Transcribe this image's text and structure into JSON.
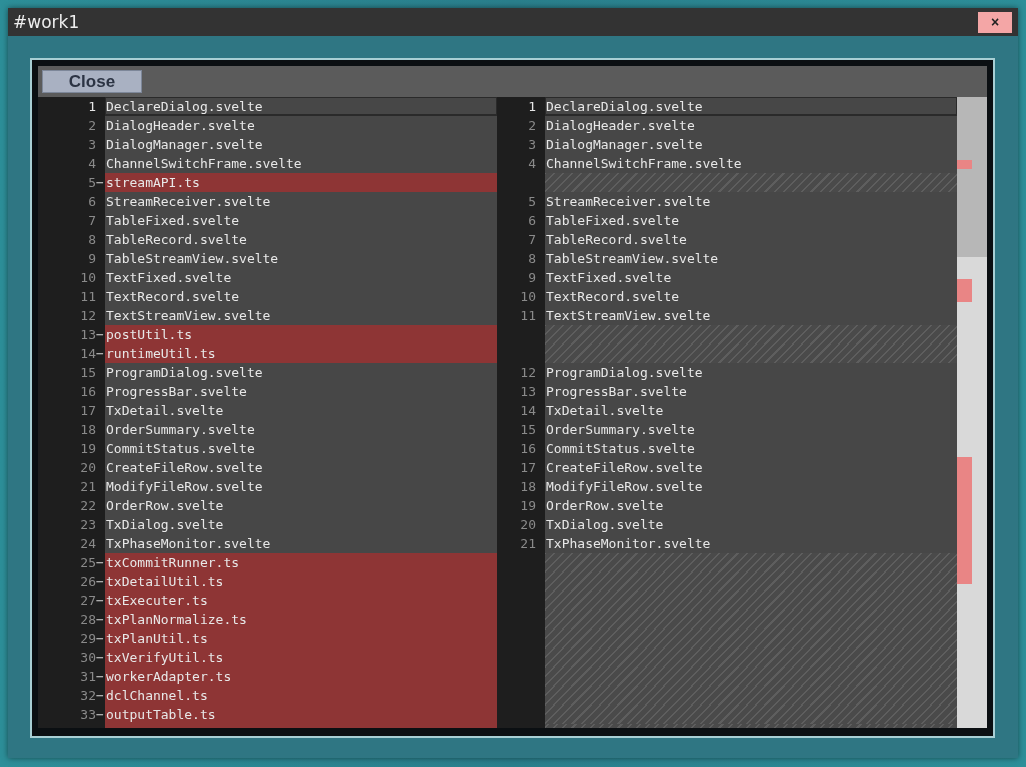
{
  "window": {
    "title": "#work1",
    "close_label": "×"
  },
  "dialog": {
    "close_button": "Close"
  },
  "diff_rows": [
    {
      "kind": "same",
      "current": true,
      "left_number": "1",
      "left_text": "DeclareDialog.svelte",
      "right_number": "1",
      "right_text": "DeclareDialog.svelte"
    },
    {
      "kind": "same",
      "current": false,
      "left_number": "2",
      "left_text": "DialogHeader.svelte",
      "right_number": "2",
      "right_text": "DialogHeader.svelte"
    },
    {
      "kind": "same",
      "current": false,
      "left_number": "3",
      "left_text": "DialogManager.svelte",
      "right_number": "3",
      "right_text": "DialogManager.svelte"
    },
    {
      "kind": "same",
      "current": false,
      "left_number": "4",
      "left_text": "ChannelSwitchFrame.svelte",
      "right_number": "4",
      "right_text": "ChannelSwitchFrame.svelte"
    },
    {
      "kind": "removed",
      "current": false,
      "left_number": "5",
      "marker": "−",
      "left_text": "streamAPI.ts"
    },
    {
      "kind": "same",
      "current": false,
      "left_number": "6",
      "left_text": "StreamReceiver.svelte",
      "right_number": "5",
      "right_text": "StreamReceiver.svelte"
    },
    {
      "kind": "same",
      "current": false,
      "left_number": "7",
      "left_text": "TableFixed.svelte",
      "right_number": "6",
      "right_text": "TableFixed.svelte"
    },
    {
      "kind": "same",
      "current": false,
      "left_number": "8",
      "left_text": "TableRecord.svelte",
      "right_number": "7",
      "right_text": "TableRecord.svelte"
    },
    {
      "kind": "same",
      "current": false,
      "left_number": "9",
      "left_text": "TableStreamView.svelte",
      "right_number": "8",
      "right_text": "TableStreamView.svelte"
    },
    {
      "kind": "same",
      "current": false,
      "left_number": "10",
      "left_text": "TextFixed.svelte",
      "right_number": "9",
      "right_text": "TextFixed.svelte"
    },
    {
      "kind": "same",
      "current": false,
      "left_number": "11",
      "left_text": "TextRecord.svelte",
      "right_number": "10",
      "right_text": "TextRecord.svelte"
    },
    {
      "kind": "same",
      "current": false,
      "left_number": "12",
      "left_text": "TextStreamView.svelte",
      "right_number": "11",
      "right_text": "TextStreamView.svelte"
    },
    {
      "kind": "removed",
      "current": false,
      "left_number": "13",
      "marker": "−",
      "left_text": "postUtil.ts"
    },
    {
      "kind": "removed",
      "current": false,
      "left_number": "14",
      "marker": "−",
      "left_text": "runtimeUtil.ts"
    },
    {
      "kind": "same",
      "current": false,
      "left_number": "15",
      "left_text": "ProgramDialog.svelte",
      "right_number": "12",
      "right_text": "ProgramDialog.svelte"
    },
    {
      "kind": "same",
      "current": false,
      "left_number": "16",
      "left_text": "ProgressBar.svelte",
      "right_number": "13",
      "right_text": "ProgressBar.svelte"
    },
    {
      "kind": "same",
      "current": false,
      "left_number": "17",
      "left_text": "TxDetail.svelte",
      "right_number": "14",
      "right_text": "TxDetail.svelte"
    },
    {
      "kind": "same",
      "current": false,
      "left_number": "18",
      "left_text": "OrderSummary.svelte",
      "right_number": "15",
      "right_text": "OrderSummary.svelte"
    },
    {
      "kind": "same",
      "current": false,
      "left_number": "19",
      "left_text": "CommitStatus.svelte",
      "right_number": "16",
      "right_text": "CommitStatus.svelte"
    },
    {
      "kind": "same",
      "current": false,
      "left_number": "20",
      "left_text": "CreateFileRow.svelte",
      "right_number": "17",
      "right_text": "CreateFileRow.svelte"
    },
    {
      "kind": "same",
      "current": false,
      "left_number": "21",
      "left_text": "ModifyFileRow.svelte",
      "right_number": "18",
      "right_text": "ModifyFileRow.svelte"
    },
    {
      "kind": "same",
      "current": false,
      "left_number": "22",
      "left_text": "OrderRow.svelte",
      "right_number": "19",
      "right_text": "OrderRow.svelte"
    },
    {
      "kind": "same",
      "current": false,
      "left_number": "23",
      "left_text": "TxDialog.svelte",
      "right_number": "20",
      "right_text": "TxDialog.svelte"
    },
    {
      "kind": "same",
      "current": false,
      "left_number": "24",
      "left_text": "TxPhaseMonitor.svelte",
      "right_number": "21",
      "right_text": "TxPhaseMonitor.svelte"
    },
    {
      "kind": "removed",
      "current": false,
      "left_number": "25",
      "marker": "−",
      "left_text": "txCommitRunner.ts"
    },
    {
      "kind": "removed",
      "current": false,
      "left_number": "26",
      "marker": "−",
      "left_text": "txDetailUtil.ts"
    },
    {
      "kind": "removed",
      "current": false,
      "left_number": "27",
      "marker": "−",
      "left_text": "txExecuter.ts"
    },
    {
      "kind": "removed",
      "current": false,
      "left_number": "28",
      "marker": "−",
      "left_text": "txPlanNormalize.ts"
    },
    {
      "kind": "removed",
      "current": false,
      "left_number": "29",
      "marker": "−",
      "left_text": "txPlanUtil.ts"
    },
    {
      "kind": "removed",
      "current": false,
      "left_number": "30",
      "marker": "−",
      "left_text": "txVerifyUtil.ts"
    },
    {
      "kind": "removed",
      "current": false,
      "left_number": "31",
      "marker": "−",
      "left_text": "workerAdapter.ts"
    },
    {
      "kind": "removed",
      "current": false,
      "left_number": "32",
      "marker": "−",
      "left_text": "dclChannel.ts"
    },
    {
      "kind": "removed",
      "current": false,
      "left_number": "33",
      "marker": "−",
      "left_text": "outputTable.ts"
    }
  ]
}
